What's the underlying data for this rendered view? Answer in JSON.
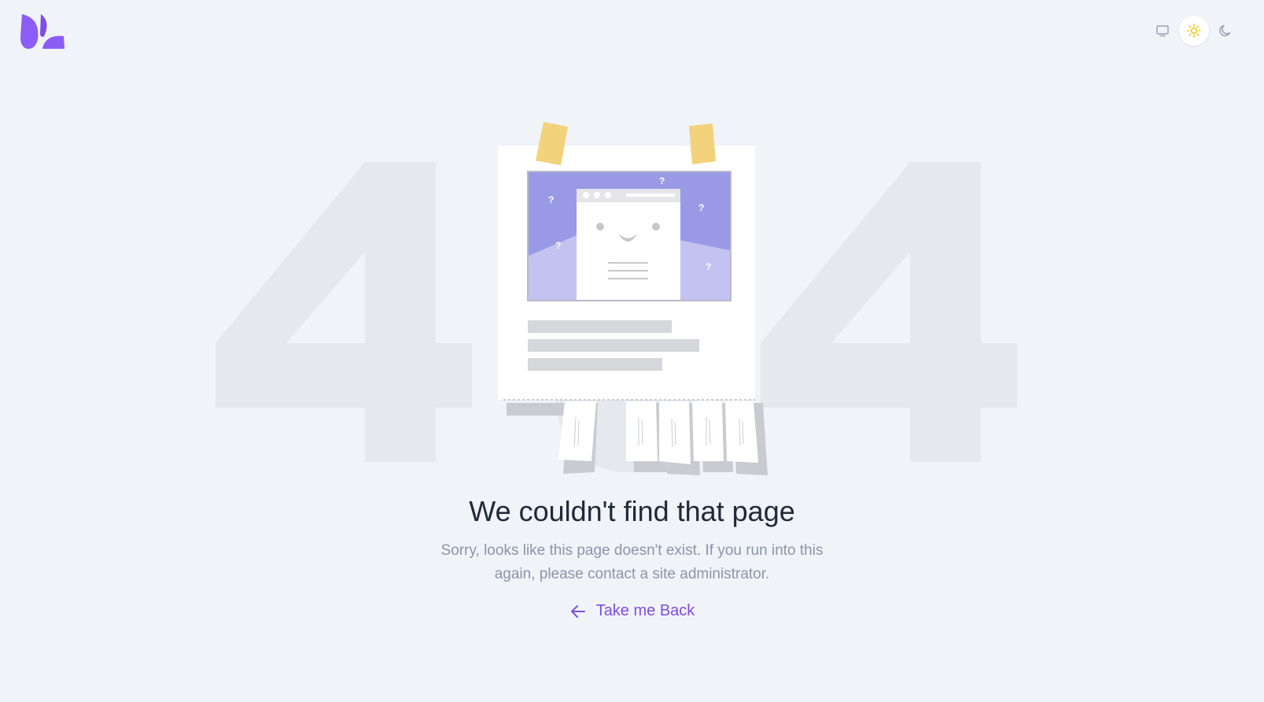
{
  "header": {
    "logo_icon": "leaf-logo-icon",
    "theme_options": [
      {
        "name": "system",
        "icon": "monitor-icon"
      },
      {
        "name": "light",
        "icon": "sun-icon",
        "active": true
      },
      {
        "name": "dark",
        "icon": "moon-icon"
      }
    ]
  },
  "background": {
    "code_digit_left": "4",
    "code_digit_right": "4"
  },
  "error": {
    "title": "We couldn't find that page",
    "message": "Sorry, looks like this page doesn't exist. If you run into this again, please contact a site administrator.",
    "back_label": "Take me Back",
    "back_icon": "arrow-left-icon"
  },
  "colors": {
    "accent": "#7c4fe0",
    "brand": "#8b5cf6",
    "background": "#f0f3f8",
    "title_text": "#1f2937",
    "body_text": "#8b95a7",
    "sun": "#f5c518"
  }
}
